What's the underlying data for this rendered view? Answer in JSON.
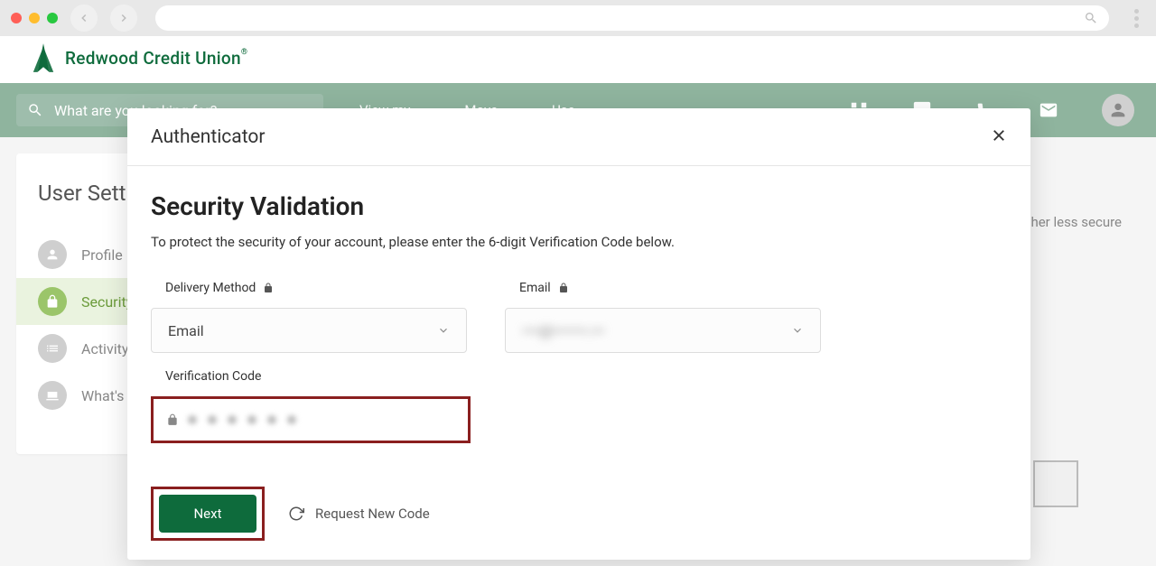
{
  "chrome": {
    "url": ""
  },
  "logo": {
    "text": "Redwood Credit Union"
  },
  "nav": {
    "search_placeholder": "What are you looking for?",
    "links": [
      "View my",
      "Move",
      "Use"
    ]
  },
  "sidebar": {
    "title": "User Settings",
    "items": [
      {
        "label": "Profile"
      },
      {
        "label": "Security"
      },
      {
        "label": "Activity"
      },
      {
        "label": "What's"
      }
    ]
  },
  "right_text": "…other less secure",
  "modal": {
    "title": "Authenticator",
    "heading": "Security Validation",
    "subtext": "To protect the security of your account, please enter the 6-digit Verification Code below.",
    "delivery_label": "Delivery Method",
    "delivery_value": "Email",
    "email_label": "Email",
    "email_value": "••••@••••••••.•••",
    "code_label": "Verification Code",
    "next_label": "Next",
    "request_label": "Request New Code"
  }
}
